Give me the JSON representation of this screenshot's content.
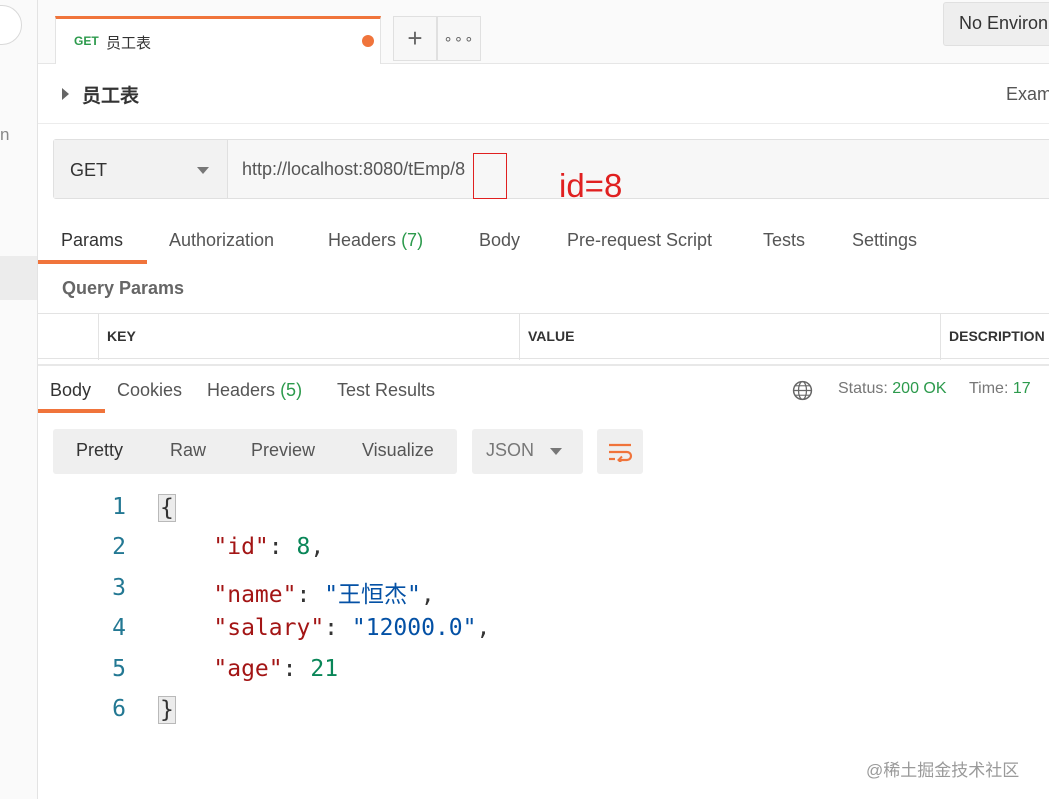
{
  "sidebar": {
    "fragment_text": "n"
  },
  "tab": {
    "method": "GET",
    "name": "员工表",
    "plus_icon": "+",
    "more_icon": "∘∘∘"
  },
  "environment": {
    "label": "No Environment"
  },
  "request": {
    "title": "员工表",
    "examples_label": "Exam",
    "method": "GET",
    "url": "http://localhost:8080/tEmp/8",
    "annotation": "id=8"
  },
  "request_tabs": {
    "params": "Params",
    "authorization": "Authorization",
    "headers": "Headers",
    "headers_count": "(7)",
    "body": "Body",
    "prerequest": "Pre-request Script",
    "tests": "Tests",
    "settings": "Settings"
  },
  "query_params": {
    "label": "Query Params",
    "columns": [
      "KEY",
      "VALUE",
      "DESCRIPTION"
    ]
  },
  "response_tabs": {
    "body": "Body",
    "cookies": "Cookies",
    "headers": "Headers",
    "headers_count": "(5)",
    "test_results": "Test Results"
  },
  "response_status": {
    "status_label": "Status:",
    "status_value": "200 OK",
    "time_label": "Time:",
    "time_value": "17"
  },
  "view_modes": [
    "Pretty",
    "Raw",
    "Preview",
    "Visualize"
  ],
  "format": "JSON",
  "code": {
    "line_numbers": [
      "1",
      "2",
      "3",
      "4",
      "5",
      "6"
    ],
    "open_brace": "{",
    "close_brace": "}",
    "fields": [
      {
        "key": "\"id\"",
        "value": "8",
        "trail": ","
      },
      {
        "key": "\"name\"",
        "value": "\"王恒杰\"",
        "trail": ","
      },
      {
        "key": "\"salary\"",
        "value": "\"12000.0\"",
        "trail": ","
      },
      {
        "key": "\"age\"",
        "value": "21",
        "trail": ""
      }
    ]
  },
  "watermark": "@稀土掘金技术社区",
  "colors": {
    "accent": "#f0743b",
    "get_method": "#2c9a4c",
    "annotation_red": "#e02020"
  }
}
